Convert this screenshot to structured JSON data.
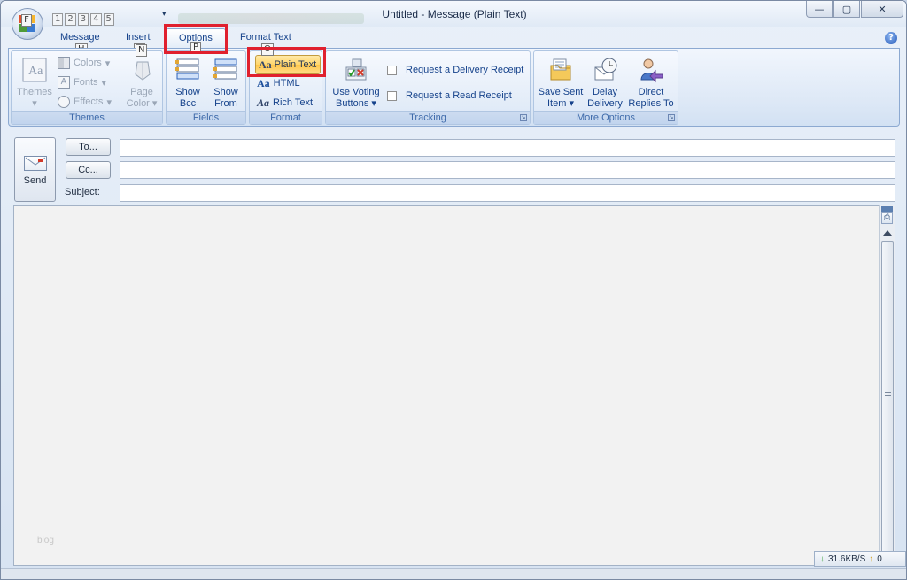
{
  "window": {
    "title": "Untitled - Message (Plain Text)",
    "controls": {
      "minimize": "—",
      "maximize": "▢",
      "close": "✕"
    }
  },
  "office_button": {
    "keytip": "F"
  },
  "quick_access": {
    "keytips": [
      "1",
      "2",
      "3",
      "4",
      "5"
    ]
  },
  "tabs": [
    {
      "label": "Message",
      "keytip": "H"
    },
    {
      "label": "Insert",
      "keytip": "N"
    },
    {
      "label": "Options",
      "keytip": "P",
      "active": true
    },
    {
      "label": "Format Text",
      "keytip": "O"
    }
  ],
  "help": {
    "glyph": "?"
  },
  "ribbon": {
    "themes": {
      "label": "Themes",
      "themes_btn": "Themes",
      "colors": "Colors",
      "fonts": "Fonts",
      "effects": "Effects",
      "page_color_line1": "Page",
      "page_color_line2": "Color"
    },
    "fields": {
      "label": "Fields",
      "show_bcc_line1": "Show",
      "show_bcc_line2": "Bcc",
      "show_from_line1": "Show",
      "show_from_line2": "From"
    },
    "format": {
      "label": "Format",
      "plain_text": "Plain Text",
      "html": "HTML",
      "rich_text": "Rich Text",
      "aa": "Aa"
    },
    "tracking": {
      "label": "Tracking",
      "voting_line1": "Use Voting",
      "voting_line2": "Buttons",
      "delivery_receipt": "Request a Delivery Receipt",
      "read_receipt": "Request a Read Receipt",
      "delivery_checked": false,
      "read_checked": false
    },
    "more_options": {
      "label": "More Options",
      "save_sent_line1": "Save Sent",
      "save_sent_line2": "Item",
      "delay_line1": "Delay",
      "delay_line2": "Delivery",
      "direct_line1": "Direct",
      "direct_line2": "Replies To"
    }
  },
  "compose": {
    "send": "Send",
    "to_btn": "To...",
    "cc_btn": "Cc...",
    "subject_label": "Subject:",
    "to_value": "",
    "cc_value": "",
    "subject_value": ""
  },
  "body": {
    "text": "",
    "watermark": "blog"
  },
  "status": {
    "down_speed": "31.6KB/S",
    "up_value": "0"
  },
  "colors": {
    "highlight": "#e0202e",
    "accent": "#15428b"
  }
}
